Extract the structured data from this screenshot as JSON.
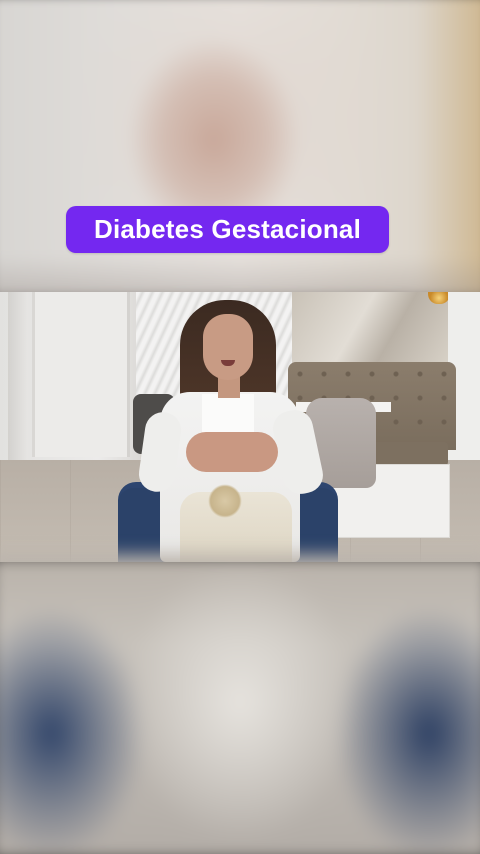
{
  "overlay": {
    "title": "Diabetes Gestacional",
    "title_bg_color": "#7428f0",
    "title_text_color": "#ffffff"
  }
}
